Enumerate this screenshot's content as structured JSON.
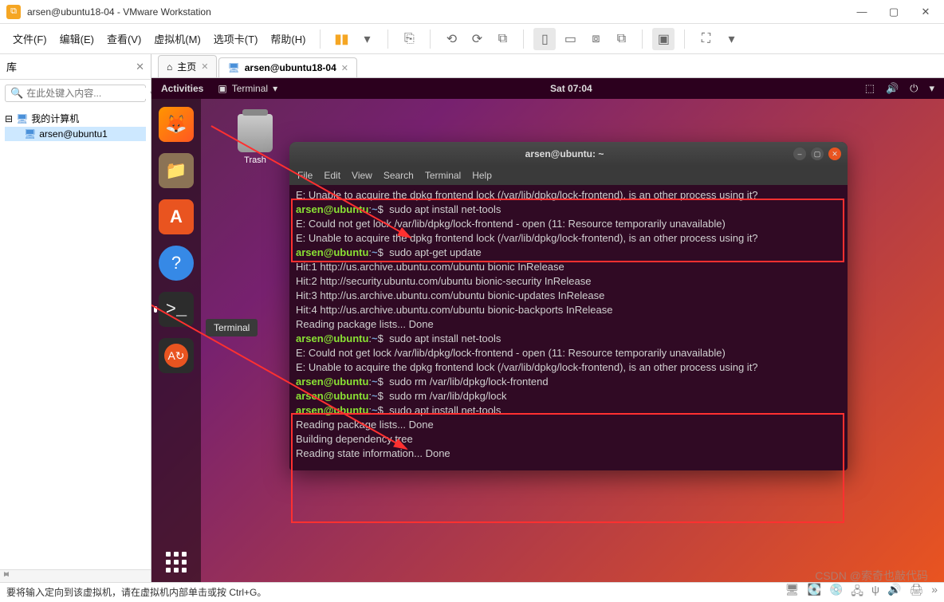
{
  "window": {
    "title": "arsen@ubuntu18-04 - VMware Workstation"
  },
  "menubar": {
    "file": "文件(F)",
    "edit": "编辑(E)",
    "view": "查看(V)",
    "vm": "虚拟机(M)",
    "tabs": "选项卡(T)",
    "help": "帮助(H)"
  },
  "library": {
    "title": "库",
    "search_placeholder": "在此处键入内容...",
    "root": "我的计算机",
    "vm_item": "arsen@ubuntu1"
  },
  "tabs": {
    "home": "主页",
    "vm": "arsen@ubuntu18-04"
  },
  "ubuntu": {
    "activities": "Activities",
    "app_menu": "Terminal",
    "clock": "Sat 07:04",
    "trash": "Trash",
    "dock_tooltip": "Terminal"
  },
  "terminal": {
    "title": "arsen@ubuntu: ~",
    "menu": {
      "file": "File",
      "edit": "Edit",
      "view": "View",
      "search": "Search",
      "terminal": "Terminal",
      "help": "Help"
    },
    "lines": {
      "l1": "E: Unable to acquire the dpkg frontend lock (/var/lib/dpkg/lock-frontend), is an other process using it?",
      "p1_cmd": "sudo apt install net-tools",
      "l2": "E: Could not get lock /var/lib/dpkg/lock-frontend - open (11: Resource temporarily unavailable)",
      "l3": "E: Unable to acquire the dpkg frontend lock (/var/lib/dpkg/lock-frontend), is an other process using it?",
      "p2_cmd": "sudo apt-get update",
      "l4": "Hit:1 http://us.archive.ubuntu.com/ubuntu bionic InRelease",
      "l5": "Hit:2 http://security.ubuntu.com/ubuntu bionic-security InRelease",
      "l6": "Hit:3 http://us.archive.ubuntu.com/ubuntu bionic-updates InRelease",
      "l7": "Hit:4 http://us.archive.ubuntu.com/ubuntu bionic-backports InRelease",
      "l8": "Reading package lists... Done",
      "p3_cmd": "sudo apt install net-tools",
      "l9": "E: Could not get lock /var/lib/dpkg/lock-frontend - open (11: Resource temporarily unavailable)",
      "l10": "E: Unable to acquire the dpkg frontend lock (/var/lib/dpkg/lock-frontend), is an other process using it?",
      "p4_cmd": "sudo rm /var/lib/dpkg/lock-frontend",
      "p5_cmd": "sudo rm /var/lib/dpkg/lock",
      "p6_cmd": "sudo apt install net-tools",
      "l11": "Reading package lists... Done",
      "l12": "Building dependency tree",
      "l13": "Reading state information... Done"
    },
    "prompt_user": "arsen@ubuntu",
    "prompt_path": "~",
    "prompt_sep": ":",
    "prompt_sym": "$"
  },
  "statusbar": {
    "text": "要将输入定向到该虚拟机，请在虚拟机内部单击或按 Ctrl+G。"
  },
  "watermark": "CSDN @索奇也敲代码"
}
